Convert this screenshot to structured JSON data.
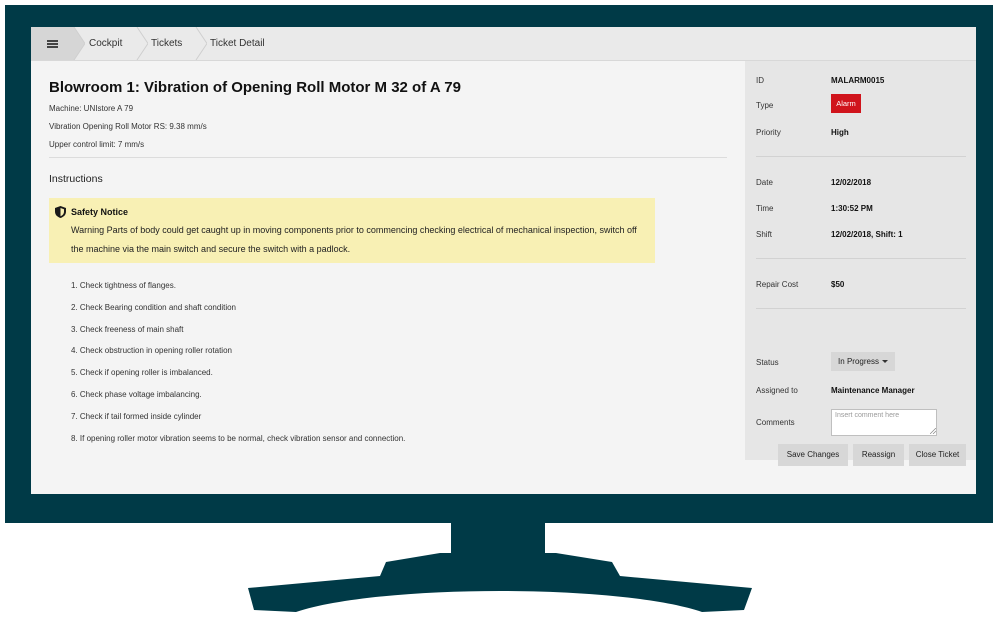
{
  "breadcrumb": {
    "items": [
      "Cockpit",
      "Tickets",
      "Ticket Detail"
    ]
  },
  "ticket": {
    "title": "Blowroom 1: Vibration of Opening Roll Motor M 32 of A 79",
    "meta": [
      "Machine: UNIstore A 79",
      "Vibration Opening Roll Motor RS: 9.38 mm/s",
      "Upper control limit: 7 mm/s"
    ]
  },
  "instructions": {
    "heading": "Instructions",
    "notice": {
      "icon": "shield-icon",
      "title": "Safety Notice",
      "body": "Warning Parts of body could get caught up in moving components prior to commencing checking electrical of mechanical inspection, switch off the machine via the main switch and secure the switch with a padlock."
    },
    "steps": [
      "1. Check tightness of flanges.",
      "2. Check Bearing condition and shaft condition",
      "3. Check freeness of main shaft",
      "4. Check obstruction in opening roller rotation",
      "5. Check if opening roller is imbalanced.",
      "6. Check phase voltage imbalancing.",
      "7. Check if tail formed inside cylinder",
      "8. If opening roller motor vibration seems to be normal, check vibration sensor and connection."
    ]
  },
  "details": {
    "id": {
      "label": "ID",
      "value": "MALARM0015"
    },
    "type": {
      "label": "Type",
      "value": "Alarm",
      "color": "#d0141c"
    },
    "priority": {
      "label": "Priority",
      "value": "High"
    },
    "date": {
      "label": "Date",
      "value": "12/02/2018"
    },
    "time": {
      "label": "Time",
      "value": "1:30:52 PM"
    },
    "shift": {
      "label": "Shift",
      "value": "12/02/2018, Shift: 1"
    },
    "repair_cost": {
      "label": "Repair Cost",
      "value": "$50"
    },
    "status": {
      "label": "Status",
      "value": "In Progress"
    },
    "assigned_to": {
      "label": "Assigned to",
      "value": "Maintenance Manager"
    },
    "comments": {
      "label": "Comments",
      "placeholder": "Insert comment here"
    }
  },
  "actions": {
    "save": "Save Changes",
    "reassign": "Reassign",
    "close": "Close Ticket"
  },
  "colors": {
    "monitor": "#003a47",
    "alarm": "#d0141c",
    "notice_bg": "#f8f0b4"
  }
}
